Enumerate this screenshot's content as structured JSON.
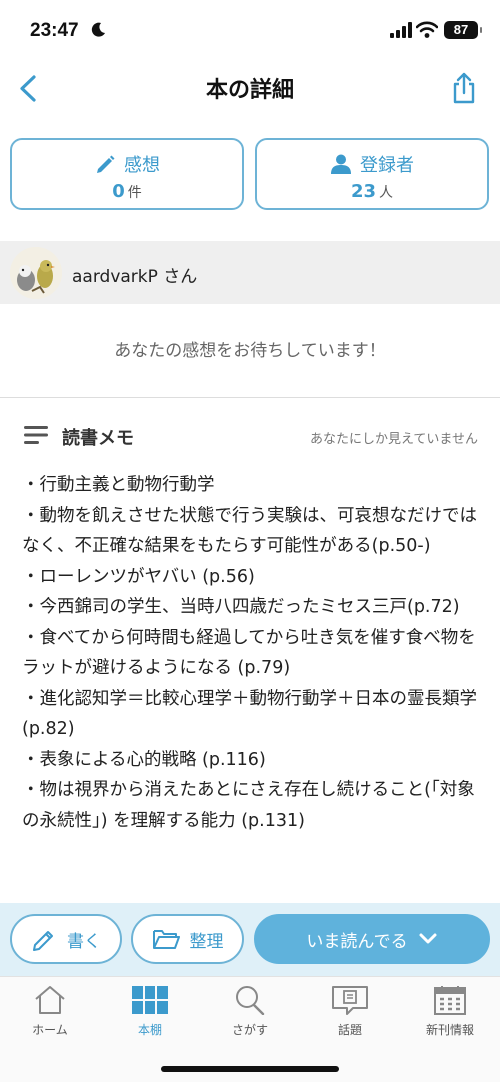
{
  "status": {
    "time": "23:47",
    "battery": "87"
  },
  "nav": {
    "title": "本の詳細"
  },
  "stats": {
    "impressions": {
      "label": "感想",
      "count": "0",
      "unit": "件"
    },
    "registrants": {
      "label": "登録者",
      "count": "23",
      "unit": "人"
    }
  },
  "user": {
    "name": "aardvarkP さん"
  },
  "awaiting_text": "あなたの感想をお待ちしています！",
  "memo": {
    "title": "読書メモ",
    "visibility_note": "あなたにしか見えていません",
    "lines": [
      "・行動主義と動物行動学",
      "・動物を飢えさせた状態で行う実験は、可哀想なだけではなく、不正確な結果をもたらす可能性がある(p.50-)",
      "・ローレンツがヤバい (p.56)",
      "・今西錦司の学生、当時八四歳だったミセス三戸(p.72)",
      "・食べてから何時間も経過してから吐き気を催す食べ物をラットが避けるようになる (p.79)",
      "・進化認知学＝比較心理学＋動物行動学＋日本の霊長類学 (p.82)",
      "・表象による心的戦略 (p.116)",
      "・物は視界から消えたあとにさえ存在し続けること(「対象の永続性」) を理解する能力 (p.131)"
    ]
  },
  "actions": {
    "write": "書く",
    "organize": "整理",
    "reading_status": "いま読んでる"
  },
  "tabs": [
    {
      "label": "ホーム"
    },
    {
      "label": "本棚"
    },
    {
      "label": "さがす"
    },
    {
      "label": "話題"
    },
    {
      "label": "新刊情報"
    }
  ],
  "colors": {
    "accent": "#3c9acc",
    "accent_light": "#5fb2dc",
    "border": "#6db3d6",
    "action_bar_bg": "#dff0f8"
  }
}
